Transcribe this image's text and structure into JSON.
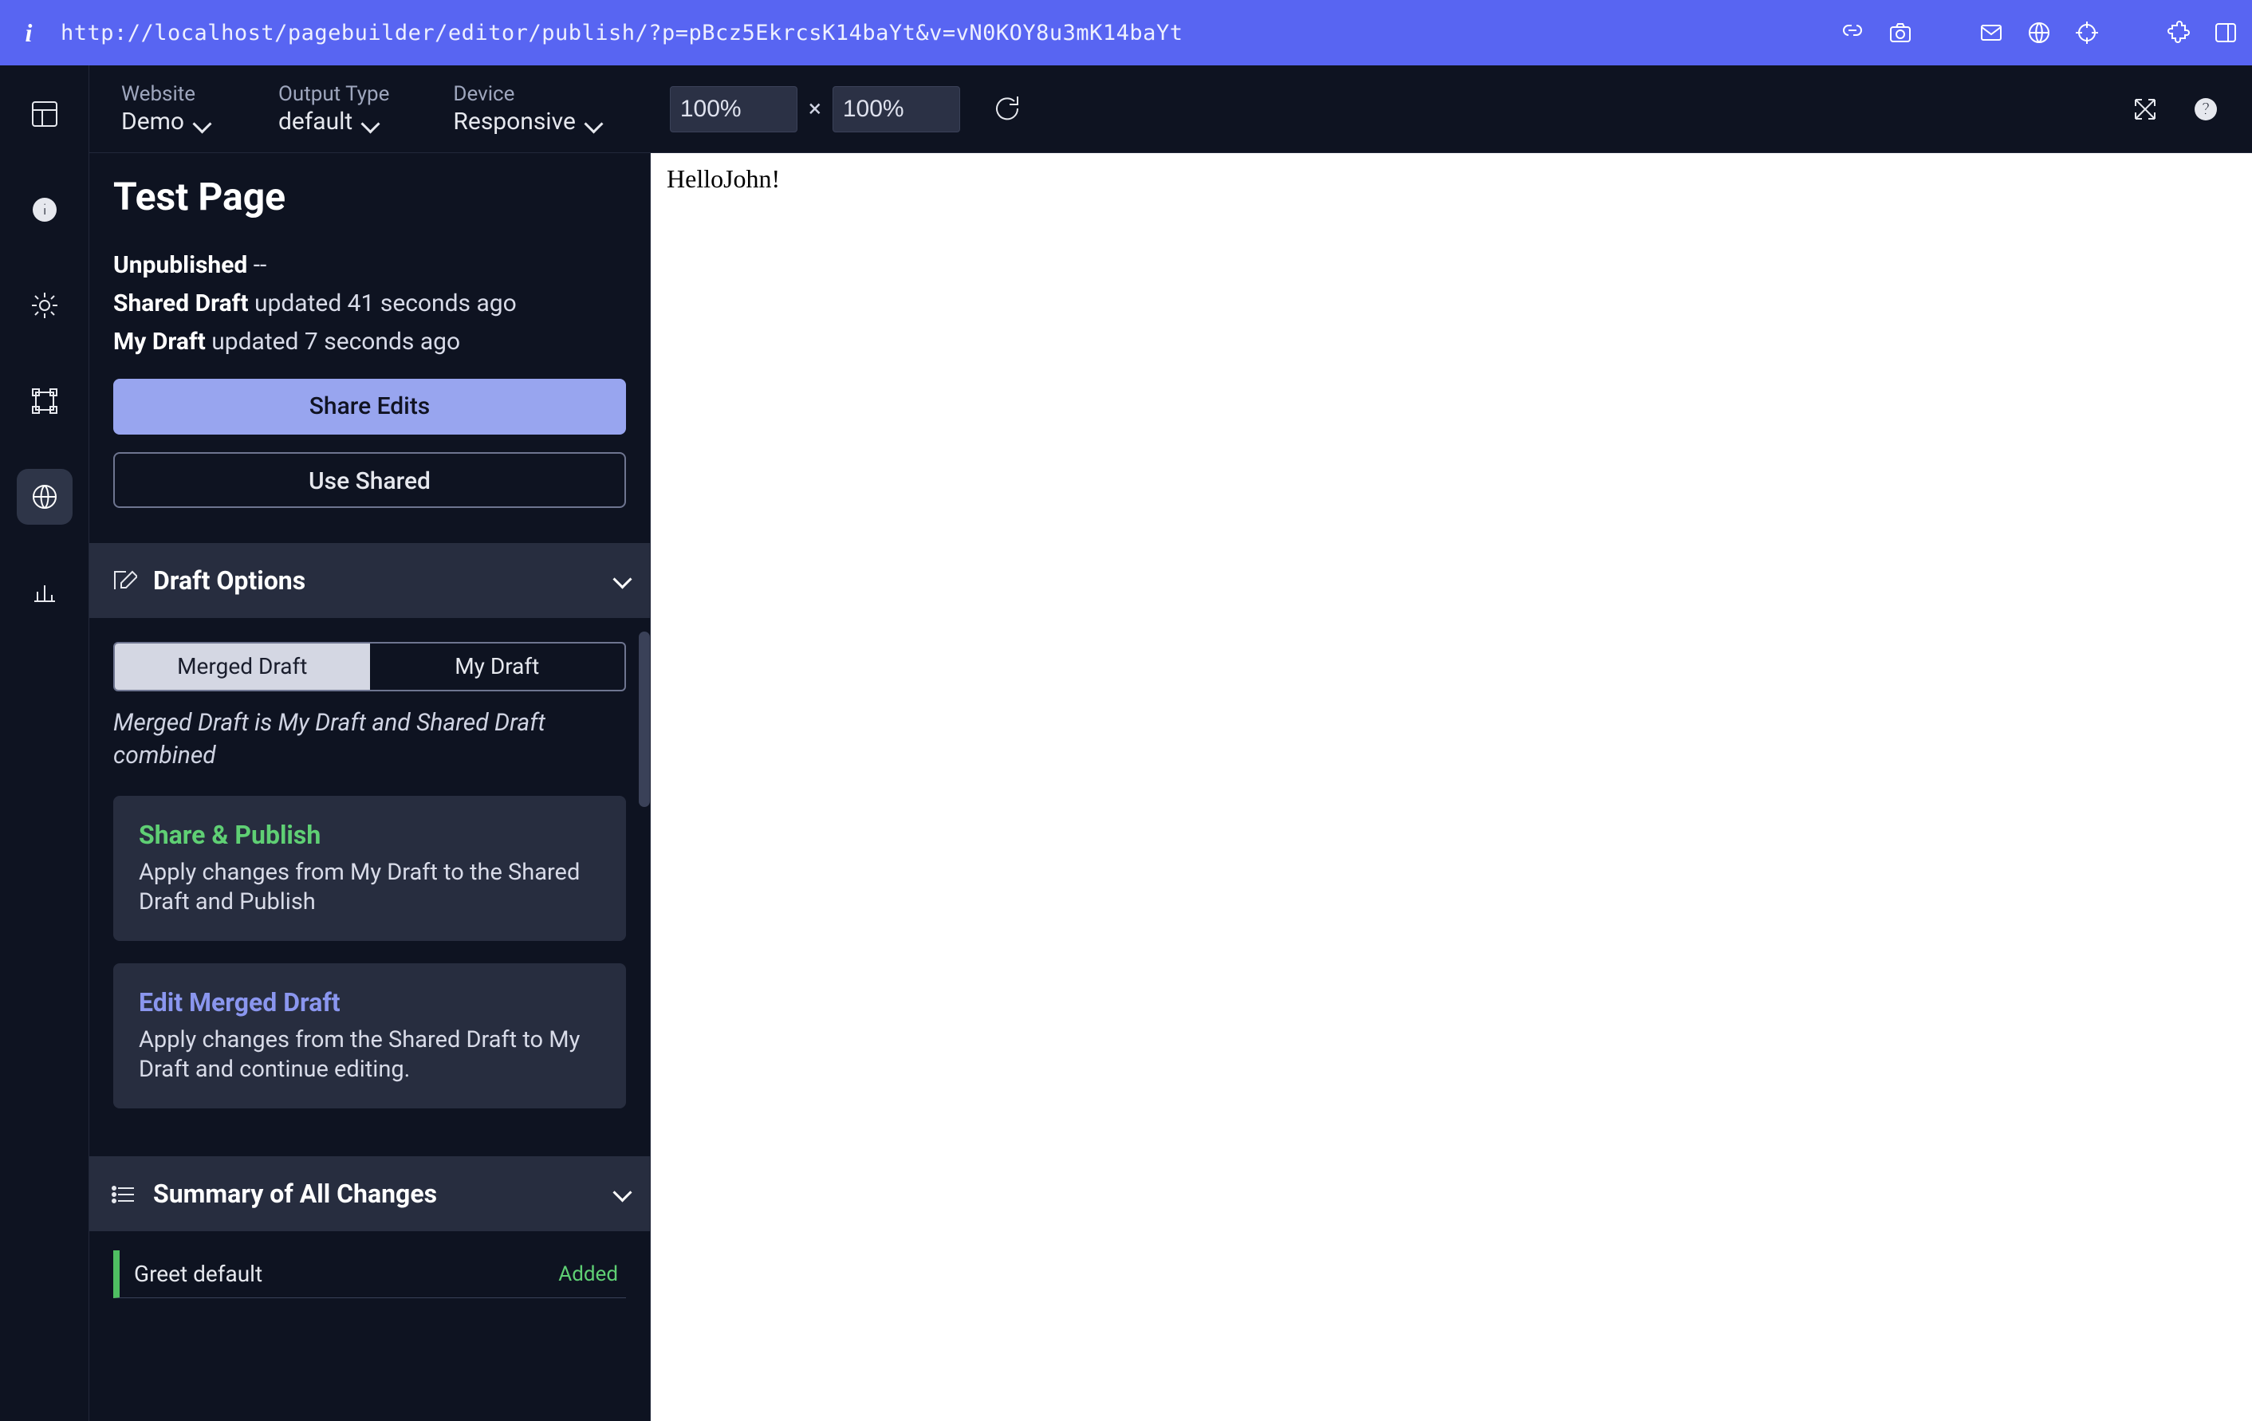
{
  "urlbar": {
    "url": "http://localhost/pagebuilder/editor/publish/?p=pBcz5EkrcsK14baYt&v=vN0KOY8u3mK14baYt"
  },
  "toolbar": {
    "website_label": "Website",
    "website_value": "Demo",
    "output_label": "Output Type",
    "output_value": "default",
    "device_label": "Device",
    "device_value": "Responsive",
    "zoom_w": "100%",
    "zoom_h": "100%",
    "zoom_sep": "×"
  },
  "panel": {
    "title": "Test Page",
    "status": {
      "unpublished_label": "Unpublished",
      "unpublished_detail": " --",
      "shared_label": "Shared Draft",
      "shared_detail": " updated 41 seconds ago",
      "mine_label": "My Draft",
      "mine_detail": " updated 7 seconds ago"
    },
    "buttons": {
      "share_edits": "Share Edits",
      "use_shared": "Use Shared"
    },
    "draft_options": {
      "header": "Draft Options",
      "seg_merged": "Merged Draft",
      "seg_mine": "My Draft",
      "note": "Merged Draft is My Draft and Shared Draft combined",
      "share_publish_title": "Share & Publish",
      "share_publish_body": "Apply changes from My Draft to the Shared Draft and Publish",
      "edit_merged_title": "Edit Merged Draft",
      "edit_merged_body": "Apply changes from the Shared Draft to My Draft and continue editing."
    },
    "summary": {
      "header": "Summary of All Changes",
      "change_label": "Greet default",
      "change_status": "Added"
    }
  },
  "preview": {
    "text": "HelloJohn!"
  }
}
